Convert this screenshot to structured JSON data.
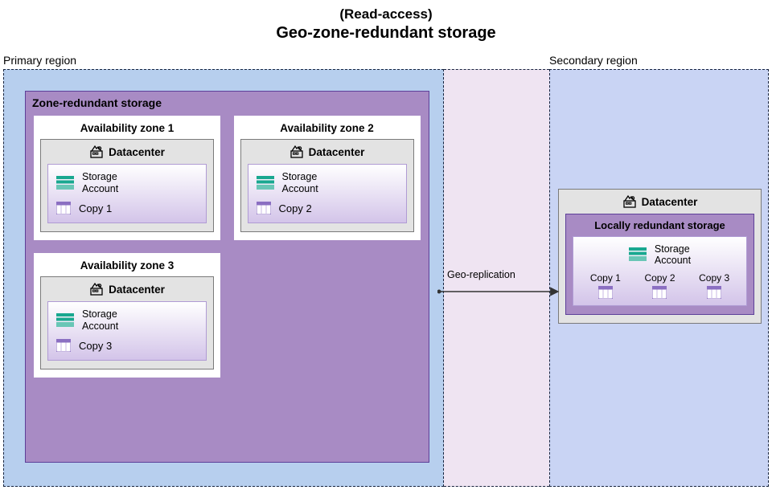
{
  "header": {
    "subtitle": "(Read-access)",
    "title": "Geo-zone-redundant storage"
  },
  "regions": {
    "primary_label": "Primary region",
    "secondary_label": "Secondary region"
  },
  "zrs": {
    "title": "Zone-redundant storage",
    "datacenter_label": "Datacenter",
    "storage_label": "Storage\nAccount",
    "zones": [
      {
        "title": "Availability zone 1",
        "copy": "Copy 1"
      },
      {
        "title": "Availability zone 2",
        "copy": "Copy 2"
      },
      {
        "title": "Availability zone 3",
        "copy": "Copy 3"
      }
    ]
  },
  "replication_label": "Geo-replication",
  "secondary": {
    "datacenter_label": "Datacenter",
    "lrs_title": "Locally redundant storage",
    "storage_label": "Storage\nAccount",
    "copies": [
      "Copy 1",
      "Copy 2",
      "Copy 3"
    ]
  }
}
